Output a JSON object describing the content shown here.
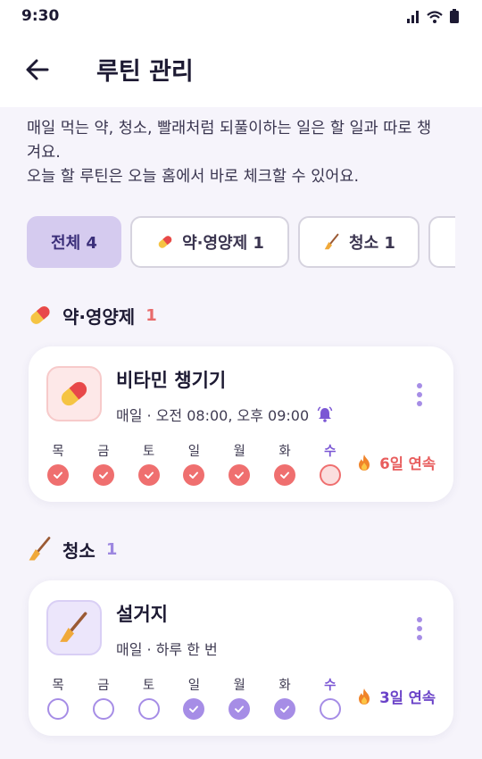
{
  "status_bar": {
    "time": "9:30"
  },
  "header": {
    "title": "루틴 관리"
  },
  "description": {
    "line1": "매일 먹는 약, 청소, 빨래처럼 되풀이하는 일은 할 일과 따로 챙",
    "line2": "겨요.",
    "line3": "오늘 할 루틴은 오늘 홈에서 바로 체크할 수 있어요."
  },
  "filters": [
    {
      "label": "전체 4",
      "active": true
    },
    {
      "label": "약·영양제 1",
      "icon": "pill-icon",
      "active": false
    },
    {
      "label": "청소 1",
      "icon": "broom-icon",
      "active": false
    }
  ],
  "sections": [
    {
      "title": "약·영양제",
      "count": "1",
      "icon": "pill-icon",
      "count_color": "#e86a6a",
      "routine": {
        "title": "비타민 챙기기",
        "schedule": "매일 · 오전 08:00, 오후 09:00",
        "alarm_icon": "bell-icon",
        "days": [
          "목",
          "금",
          "토",
          "일",
          "월",
          "화",
          "수"
        ],
        "checked": [
          true,
          true,
          true,
          true,
          true,
          true,
          false
        ],
        "today_index": 6,
        "streak": "6일 연속",
        "accent": "#ef6f6f",
        "accent_light": "#fbdede",
        "streak_color": "#e85d5d"
      }
    },
    {
      "title": "청소",
      "count": "1",
      "icon": "broom-icon",
      "count_color": "#9d87e0",
      "routine": {
        "title": "설거지",
        "schedule": "매일 · 하루 한 번",
        "days": [
          "목",
          "금",
          "토",
          "일",
          "월",
          "화",
          "수"
        ],
        "checked": [
          false,
          false,
          false,
          true,
          true,
          true,
          false
        ],
        "today_index": 6,
        "streak": "3일 연속",
        "accent": "#a68de6",
        "accent_light": "#ece6fb",
        "streak_color": "#6a42c8"
      }
    }
  ]
}
